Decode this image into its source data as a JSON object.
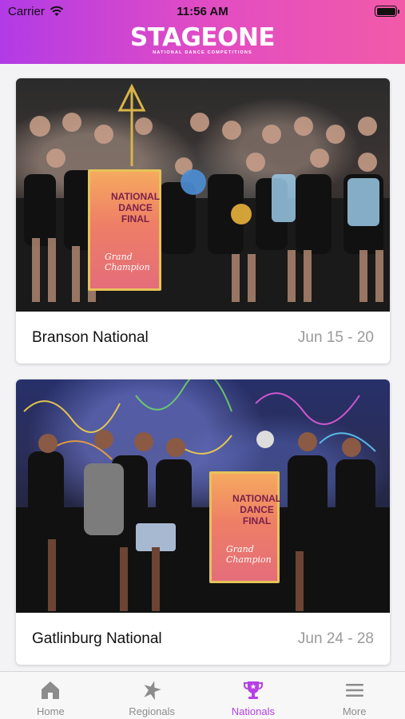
{
  "status_bar": {
    "carrier": "Carrier",
    "time": "11:56 AM"
  },
  "header": {
    "logo_main": "STAGEONE",
    "logo_sub": "NATIONAL DANCE COMPETITIONS",
    "gradient_colors": [
      "#b23be6",
      "#e14cc4",
      "#f25aa8"
    ]
  },
  "events": [
    {
      "title": "Branson National",
      "dates": "Jun 15 - 20",
      "banner_line1": "NATIONAL",
      "banner_line2": "DANCE",
      "banner_line3": "FINAL",
      "banner_script": "Grand Champion"
    },
    {
      "title": "Gatlinburg National",
      "dates": "Jun 24 - 28",
      "banner_line1": "NATIONAL",
      "banner_line2": "DANCE",
      "banner_line3": "FINAL",
      "banner_script": "Grand Champion"
    }
  ],
  "tabbar": {
    "tabs": [
      {
        "label": "Home",
        "icon": "home-icon"
      },
      {
        "label": "Regionals",
        "icon": "star-dancer-icon"
      },
      {
        "label": "Nationals",
        "icon": "trophy-icon",
        "active": true
      },
      {
        "label": "More",
        "icon": "menu-icon"
      }
    ],
    "active_color": "#b73fe5",
    "inactive_color": "#8c8c8c"
  }
}
